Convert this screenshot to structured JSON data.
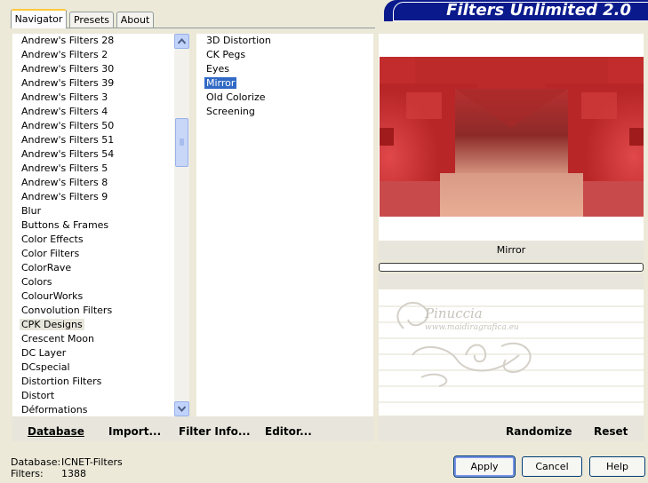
{
  "tabs": [
    {
      "label": "Navigator",
      "active": true
    },
    {
      "label": "Presets",
      "active": false
    },
    {
      "label": "About",
      "active": false
    }
  ],
  "banner": {
    "title": "Filters Unlimited 2.0",
    "color": "#0a1a8c"
  },
  "categories": [
    "Andrew's Filters 28",
    "Andrew's Filters 2",
    "Andrew's Filters 30",
    "Andrew's Filters 39",
    "Andrew's Filters 3",
    "Andrew's Filters 4",
    "Andrew's Filters 50",
    "Andrew's Filters 51",
    "Andrew's Filters 54",
    "Andrew's Filters 5",
    "Andrew's Filters 8",
    "Andrew's Filters 9",
    "Blur",
    "Buttons & Frames",
    "Color Effects",
    "Color Filters",
    "ColorRave",
    "Colors",
    "ColourWorks",
    "Convolution Filters",
    "CPK Designs",
    "Crescent Moon",
    "DC Layer",
    "DCspecial",
    "Distortion Filters",
    "Distort",
    "Déformations"
  ],
  "selected_category": "CPK Designs",
  "filters": [
    "3D Distortion",
    "CK Pegs",
    "Eyes",
    "Mirror",
    "Old Colorize",
    "Screening"
  ],
  "selected_filter": "Mirror",
  "filter_title": "Mirror",
  "footer_links": {
    "database": "Database",
    "import": "Import...",
    "filter_info": "Filter Info...",
    "editor": "Editor...",
    "randomize": "Randomize",
    "reset": "Reset"
  },
  "watermark": {
    "name": "Pinuccia",
    "url": "www.maidiragrafica.eu"
  },
  "status": {
    "database_label": "Database:",
    "database_value": "ICNET-Filters",
    "filters_label": "Filters:",
    "filters_value": "1388"
  },
  "buttons": {
    "apply": "Apply",
    "cancel": "Cancel",
    "help": "Help"
  },
  "colors": {
    "selection": "#316ac5",
    "preview_red": "#c42a2a",
    "preview_skin": "#e6a68e"
  }
}
